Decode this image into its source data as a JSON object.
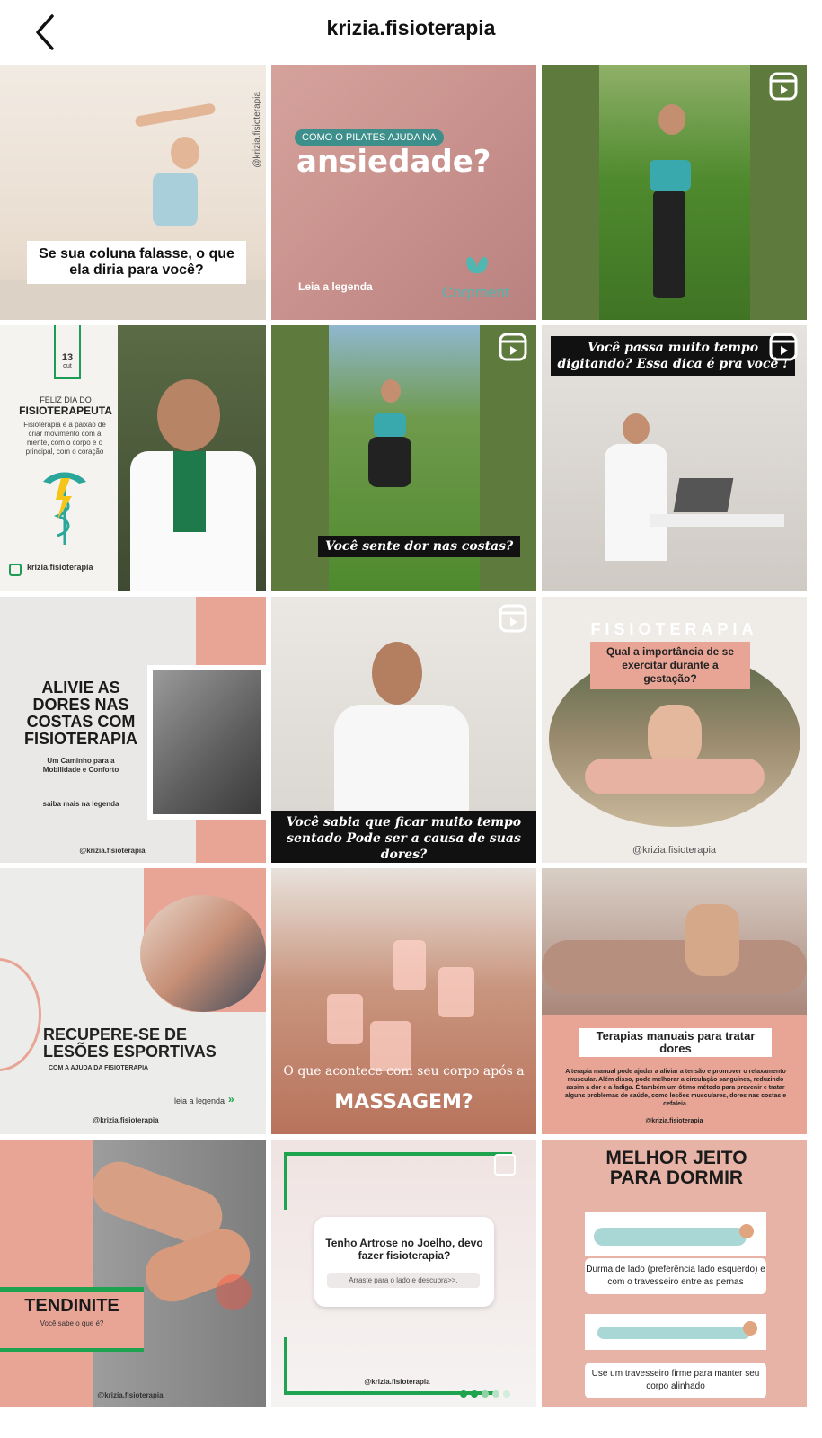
{
  "header": {
    "title": "krizia.fisioterapia"
  },
  "posts": [
    {
      "caption": "Se sua coluna falasse, o que ela diria para você?",
      "handle": "@krizia.fisioterapia"
    },
    {
      "pill": "COMO O PILATES AJUDA NA",
      "headline": "ansiedade?",
      "footer": "Leia a legenda",
      "brand": "Corpment"
    },
    {
      "reel": true
    },
    {
      "date_day": "13",
      "date_month": "out",
      "title_small": "FELIZ DIA DO",
      "title": "FISIOTERAPEUTA",
      "body": "Fisioterapia é a paixão de criar movimento com a mente, com o corpo e o principal, com o coração",
      "handle": "krizia.fisioterapia"
    },
    {
      "caption": "Você sente dor nas costas?",
      "reel": true
    },
    {
      "caption": "Você passa muito tempo digitando? Essa dica é pra você !",
      "reel": true
    },
    {
      "headline": "ALIVIE AS DORES NAS COSTAS COM FISIOTERAPIA",
      "sub": "Um Caminho para a Mobilidade e Conforto",
      "more": "saiba mais na legenda",
      "handle": "@krizia.fisioterapia"
    },
    {
      "caption": "Você sabia que ficar muito tempo sentado Pode ser a causa de suas dores?",
      "reel": true
    },
    {
      "top": "FISIOTERAPIA",
      "question": "Qual a importância de se exercitar durante a gestação?",
      "handle": "@krizia.fisioterapia"
    },
    {
      "headline": "RECUPERE-SE DE LESÕES ESPORTIVAS",
      "sub": "COM A AJUDA DA FISIOTERAPIA",
      "more": "leia a legenda",
      "handle": "@krizia.fisioterapia"
    },
    {
      "caption": "O que acontece com seu corpo após a",
      "caption_big": "MASSAGEM?"
    },
    {
      "title": "Terapias manuais para tratar dores",
      "body": "A terapia manual pode ajudar a aliviar a tensão e promover o relaxamento muscular. Além disso, pode melhorar a circulação sanguínea, reduzindo assim a dor e a fadiga. É também um ótimo método para prevenir e tratar alguns problemas de saúde, como lesões musculares, dores nas costas e cefaleia.",
      "handle": "@krizia.fisioterapia"
    },
    {
      "headline": "TENDINITE",
      "sub": "Você sabe o que é?",
      "handle": "@krizia.fisioterapia"
    },
    {
      "question": "Tenho Artrose no Joelho, devo fazer fisioterapia?",
      "button": "Arraste para o lado e descubra>>.",
      "handle": "@krizia.fisioterapia"
    },
    {
      "headline": "MELHOR JEITO PARA DORMIR",
      "tip1": "Durma de lado (preferência lado esquerdo) e com o travesseiro entre as pernas",
      "tip2": "Use um travesseiro firme para manter seu corpo alinhado"
    }
  ],
  "colors": {
    "accent_pink": "#e8a596",
    "accent_green": "#1ea34f",
    "reel_bg": "#5e7a3c"
  }
}
